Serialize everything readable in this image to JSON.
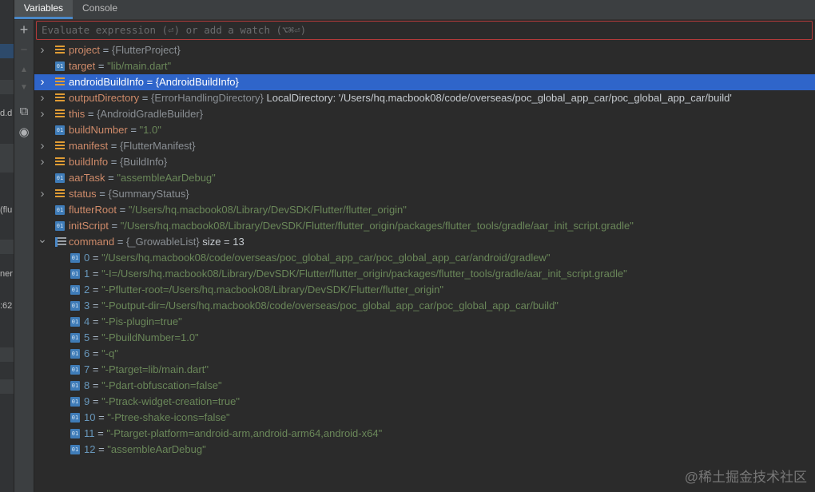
{
  "tabs": [
    {
      "label": "Variables"
    },
    {
      "label": "Console"
    }
  ],
  "left_strip": {
    "fragments": [
      "d.d",
      "(flu",
      "ner",
      ":62"
    ]
  },
  "toolbar": {
    "add_label": "+",
    "remove_label": "−",
    "up_label": "▲",
    "down_label": "▼",
    "copy_label": "⧉",
    "watch_label": "◉"
  },
  "eval": {
    "placeholder": "Evaluate expression (⏎) or add a watch (⌥⌘⏎)"
  },
  "variables": [
    {
      "name": "project",
      "type": "{FlutterProject}",
      "value": "",
      "expandable": true,
      "icon": "object"
    },
    {
      "name": "target",
      "type": "",
      "value": "\"lib/main.dart\"",
      "expandable": false,
      "icon": "primitive"
    },
    {
      "name": "androidBuildInfo",
      "type": "{AndroidBuildInfo}",
      "value": "",
      "expandable": true,
      "icon": "object",
      "selected": true
    },
    {
      "name": "outputDirectory",
      "type": "{ErrorHandlingDirectory}",
      "value": "LocalDirectory: '/Users/hq.macbook08/code/overseas/poc_global_app_car/poc_global_app_car/build'",
      "expandable": true,
      "icon": "object"
    },
    {
      "name": "this",
      "type": "{AndroidGradleBuilder}",
      "value": "",
      "expandable": true,
      "icon": "object"
    },
    {
      "name": "buildNumber",
      "type": "",
      "value": "\"1.0\"",
      "expandable": false,
      "icon": "primitive"
    },
    {
      "name": "manifest",
      "type": "{FlutterManifest}",
      "value": "",
      "expandable": true,
      "icon": "object"
    },
    {
      "name": "buildInfo",
      "type": "{BuildInfo}",
      "value": "",
      "expandable": true,
      "icon": "object"
    },
    {
      "name": "aarTask",
      "type": "",
      "value": "\"assembleAarDebug\"",
      "expandable": false,
      "icon": "primitive"
    },
    {
      "name": "status",
      "type": "{SummaryStatus}",
      "value": "",
      "expandable": true,
      "icon": "object"
    },
    {
      "name": "flutterRoot",
      "type": "",
      "value": "\"/Users/hq.macbook08/Library/DevSDK/Flutter/flutter_origin\"",
      "expandable": false,
      "icon": "primitive"
    },
    {
      "name": "initScript",
      "type": "",
      "value": "\"/Users/hq.macbook08/Library/DevSDK/Flutter/flutter_origin/packages/flutter_tools/gradle/aar_init_script.gradle\"",
      "expandable": false,
      "icon": "primitive"
    }
  ],
  "command": {
    "name": "command",
    "type": "{_GrowableList}",
    "size": "size = 13",
    "items": [
      {
        "index": "0",
        "value": "\"/Users/hq.macbook08/code/overseas/poc_global_app_car/poc_global_app_car/android/gradlew\""
      },
      {
        "index": "1",
        "value": "\"-I=/Users/hq.macbook08/Library/DevSDK/Flutter/flutter_origin/packages/flutter_tools/gradle/aar_init_script.gradle\""
      },
      {
        "index": "2",
        "value": "\"-Pflutter-root=/Users/hq.macbook08/Library/DevSDK/Flutter/flutter_origin\""
      },
      {
        "index": "3",
        "value": "\"-Poutput-dir=/Users/hq.macbook08/code/overseas/poc_global_app_car/poc_global_app_car/build\""
      },
      {
        "index": "4",
        "value": "\"-Pis-plugin=true\""
      },
      {
        "index": "5",
        "value": "\"-PbuildNumber=1.0\""
      },
      {
        "index": "6",
        "value": "\"-q\""
      },
      {
        "index": "7",
        "value": "\"-Ptarget=lib/main.dart\""
      },
      {
        "index": "8",
        "value": "\"-Pdart-obfuscation=false\""
      },
      {
        "index": "9",
        "value": "\"-Ptrack-widget-creation=true\""
      },
      {
        "index": "10",
        "value": "\"-Ptree-shake-icons=false\""
      },
      {
        "index": "11",
        "value": "\"-Ptarget-platform=android-arm,android-arm64,android-x64\""
      },
      {
        "index": "12",
        "value": "\"assembleAarDebug\""
      }
    ]
  },
  "watermark": "@稀土掘金技术社区",
  "colors": {
    "background": "#2b2b2b",
    "selection": "#2f65ca",
    "name": "#cf8b6a",
    "string": "#6a8759",
    "index": "#6897bb",
    "error_border": "#b33a3a"
  }
}
